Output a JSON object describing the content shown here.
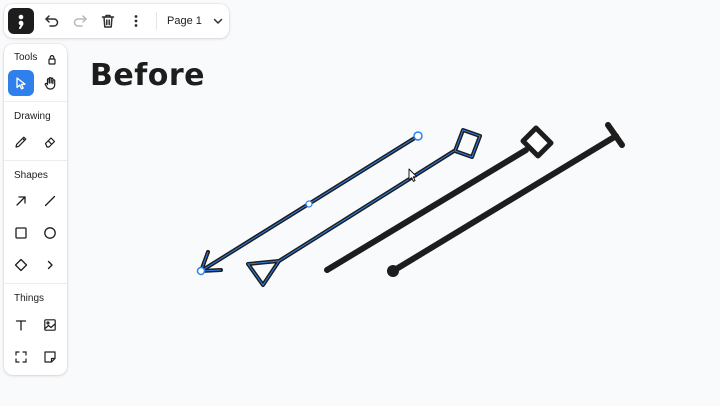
{
  "toolbar": {
    "page_label": "Page 1",
    "icons": [
      "main-menu-icon",
      "undo-icon",
      "redo-icon",
      "trash-icon",
      "more-vertical-icon",
      "chevron-down-icon"
    ]
  },
  "tools_panel": {
    "tools_heading": "Tools",
    "drawing_heading": "Drawing",
    "shapes_heading": "Shapes",
    "things_heading": "Things",
    "active_tool": "select",
    "accent_color": "#2f80ed"
  },
  "canvas": {
    "heading": "Before",
    "stroke_color": "#1d1d1d",
    "selection_color": "#2f80ed"
  }
}
